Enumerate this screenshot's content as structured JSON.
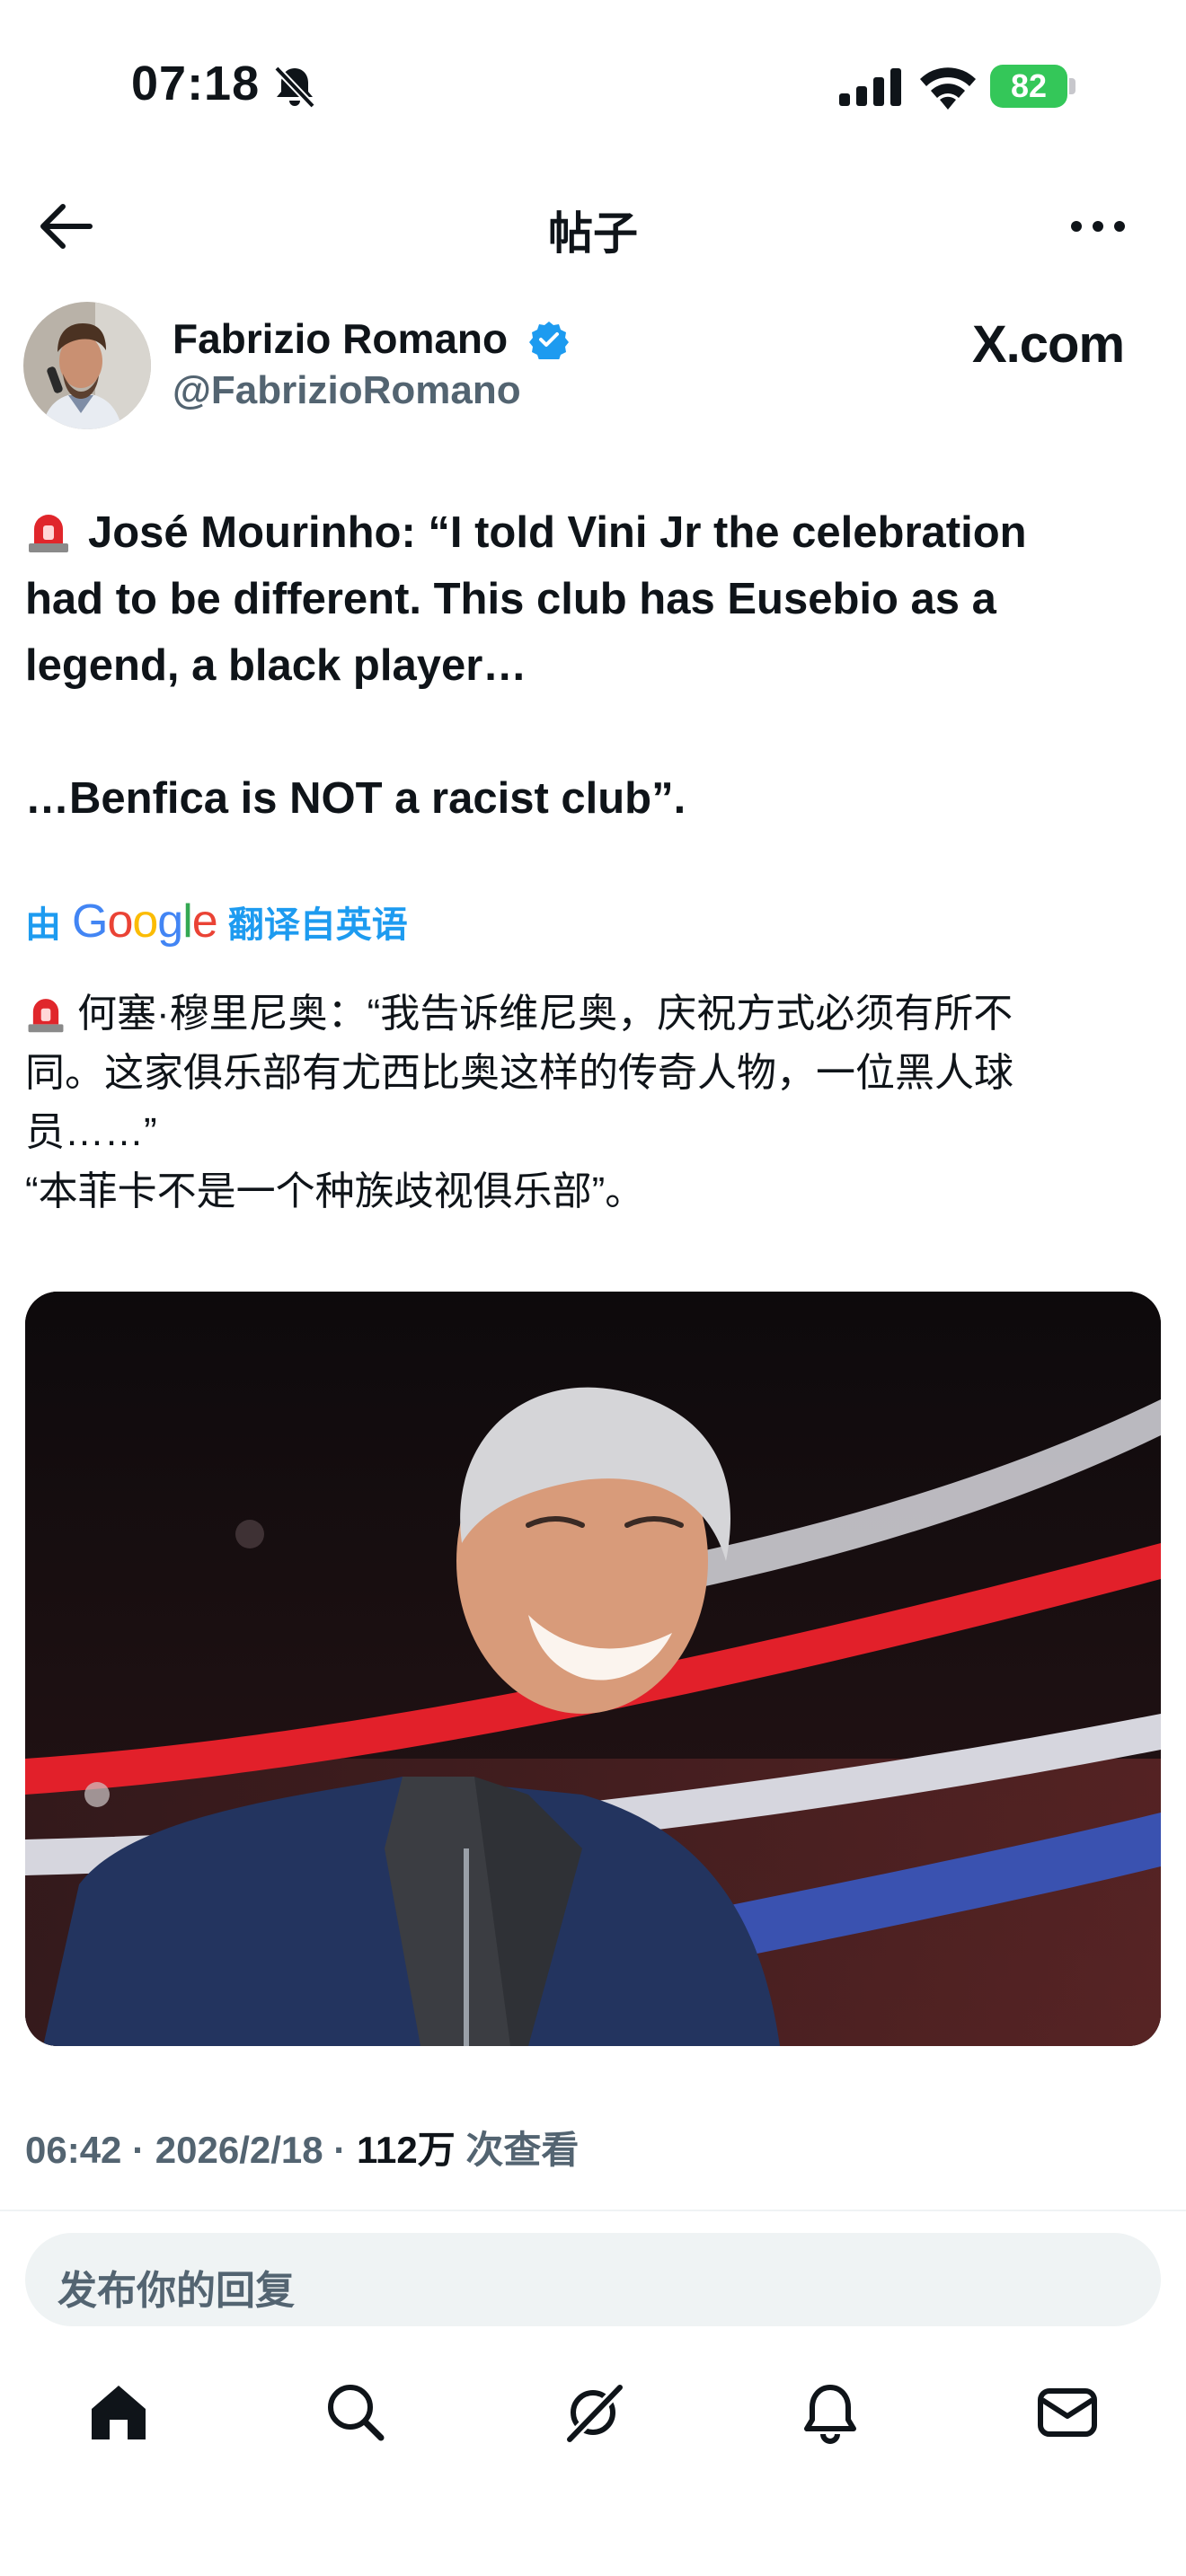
{
  "status_bar": {
    "time": "07:18",
    "battery": "82",
    "icons": [
      "bell-slash-icon",
      "signal-icon",
      "wifi-icon",
      "battery-charging-icon"
    ]
  },
  "header": {
    "title": "帖子",
    "back_icon": "arrow-left-icon",
    "more_icon": "more-horizontal-icon"
  },
  "author": {
    "name": "Fabrizio Romano",
    "handle": "@FabrizioRomano",
    "verified_icon": "verified-badge-icon",
    "watermark": "X.com"
  },
  "tweet": {
    "line1": "José Mourinho: “I told Vini Jr the celebration",
    "line2": "had to be different. This club has Eusebio as a",
    "line3": "legend, a black player…",
    "line4": "…Benfica is NOT a racist club”.",
    "siren_icon": "siren-emoji-icon"
  },
  "translation": {
    "prefix": "由",
    "provider": "Google",
    "suffix": "翻译自英语",
    "line1": "何塞·穆里尼奥：“我告诉维尼奥，庆祝方式必须有所不",
    "line2": "同。这家俱乐部有尤西比奥这样的传奇人物，一位黑人球",
    "line3": "员……”",
    "line4": "“本菲卡不是一个种族歧视俱乐部”。"
  },
  "media": {
    "icon": "photo-icon"
  },
  "meta": {
    "time": "06:42",
    "date": "2026/2/18",
    "views_count": "112万",
    "views_label": "次查看",
    "separator": "·"
  },
  "reply": {
    "placeholder": "发布你的回复"
  },
  "bottom_nav": {
    "items": [
      "home-icon",
      "search-icon",
      "grok-icon",
      "notifications-icon",
      "messages-icon"
    ]
  },
  "colors": {
    "accent": "#1d9bf0",
    "text": "#0f1419",
    "secondary": "#536471",
    "battery": "#34c759"
  }
}
